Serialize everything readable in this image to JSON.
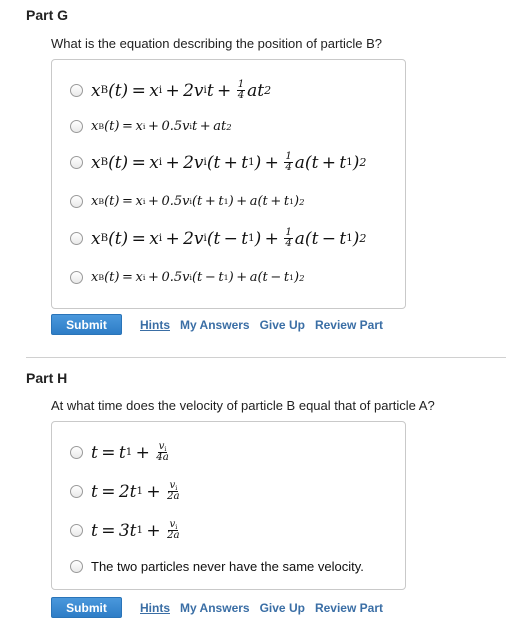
{
  "part_g": {
    "title": "Part G",
    "question": "What is the equation describing the position of particle B?",
    "submit": "Submit",
    "links": [
      "Hints",
      "My Answers",
      "Give Up",
      "Review Part"
    ]
  },
  "part_h": {
    "title": "Part H",
    "question": "At what time does the velocity of particle B equal that of particle A?",
    "submit": "Submit",
    "links": [
      "Hints",
      "My Answers",
      "Give Up",
      "Review Part"
    ],
    "last_option": "The two particles never have the same velocity."
  }
}
